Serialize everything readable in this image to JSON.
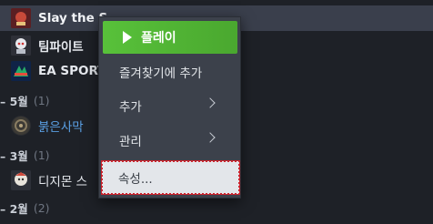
{
  "library": {
    "games": [
      {
        "label": "Slay the S",
        "icon": "slay-the-spire-icon"
      },
      {
        "label": "팀파이트",
        "icon": "teamfight-icon"
      },
      {
        "label": "EA SPORT",
        "icon": "ea-sports-icon"
      }
    ],
    "sections": [
      {
        "label": "– 5월",
        "count": "(1)"
      },
      {
        "label": "– 3월",
        "count": "(1)"
      },
      {
        "label": "– 2월",
        "count": "(2)"
      }
    ],
    "game_desert": {
      "label": "붉은사막",
      "icon": "desert-icon"
    },
    "game_digimon": {
      "label": "디지몬 스",
      "icon": "digimon-icon"
    }
  },
  "context_menu": {
    "play_label": "플레이",
    "favorite_label": "즐겨찾기에 추가",
    "add_label": "추가",
    "manage_label": "관리",
    "properties_label": "속성..."
  },
  "colors": {
    "accent_green": "#5bbf3c",
    "link_blue": "#5a9fe3",
    "focus_outline": "#c8232c"
  }
}
